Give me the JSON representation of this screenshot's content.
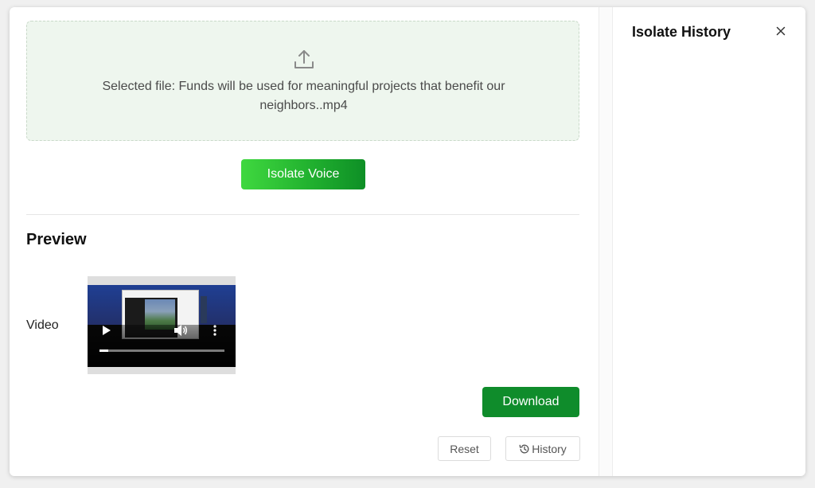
{
  "upload": {
    "icon": "upload-icon",
    "selected_file_text": "Selected file: Funds will be used for meaningful projects that benefit our neighbors..mp4"
  },
  "actions": {
    "isolate_label": "Isolate Voice",
    "download_label": "Download",
    "reset_label": "Reset",
    "history_label": "History"
  },
  "preview": {
    "title": "Preview",
    "video_label": "Video",
    "video_progress_fraction": 0.07
  },
  "side_panel": {
    "title": "Isolate History"
  },
  "colors": {
    "dropzone_bg": "#eef6ee",
    "primary_green": "#0f8c2b",
    "gradient_start": "#3fd83f",
    "gradient_end": "#0e8f26"
  }
}
